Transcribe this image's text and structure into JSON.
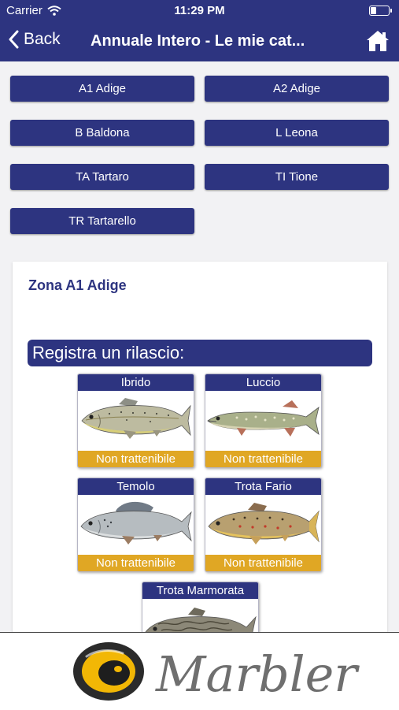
{
  "status_bar": {
    "carrier": "Carrier",
    "time": "11:29 PM",
    "battery_level": 0.35
  },
  "nav": {
    "back_label": "Back",
    "title": "Annuale Intero - Le mie cat..."
  },
  "zones": [
    "A1 Adige",
    "A2 Adige",
    "B Baldona",
    "L Leona",
    "TA Tartaro",
    "TI Tione",
    "TR Tartarello"
  ],
  "card": {
    "zone_title": "Zona A1 Adige",
    "release_header": "Registra un rilascio:",
    "fish": [
      {
        "name": "Ibrido",
        "status": "Non trattenibile"
      },
      {
        "name": "Luccio",
        "status": "Non trattenibile"
      },
      {
        "name": "Temolo",
        "status": "Non trattenibile"
      },
      {
        "name": "Trota Fario",
        "status": "Non trattenibile"
      },
      {
        "name": "Trota Marmorata",
        "status": ""
      }
    ]
  },
  "footer": {
    "logo_text": "Marbler"
  },
  "colors": {
    "primary": "#2d3480",
    "status_bg": "#e0a724",
    "content_bg": "#f2f2f4"
  },
  "icons": [
    "wifi-icon",
    "battery-icon",
    "back-chevron-icon",
    "home-icon",
    "fish-icon",
    "marbler-logo"
  ]
}
